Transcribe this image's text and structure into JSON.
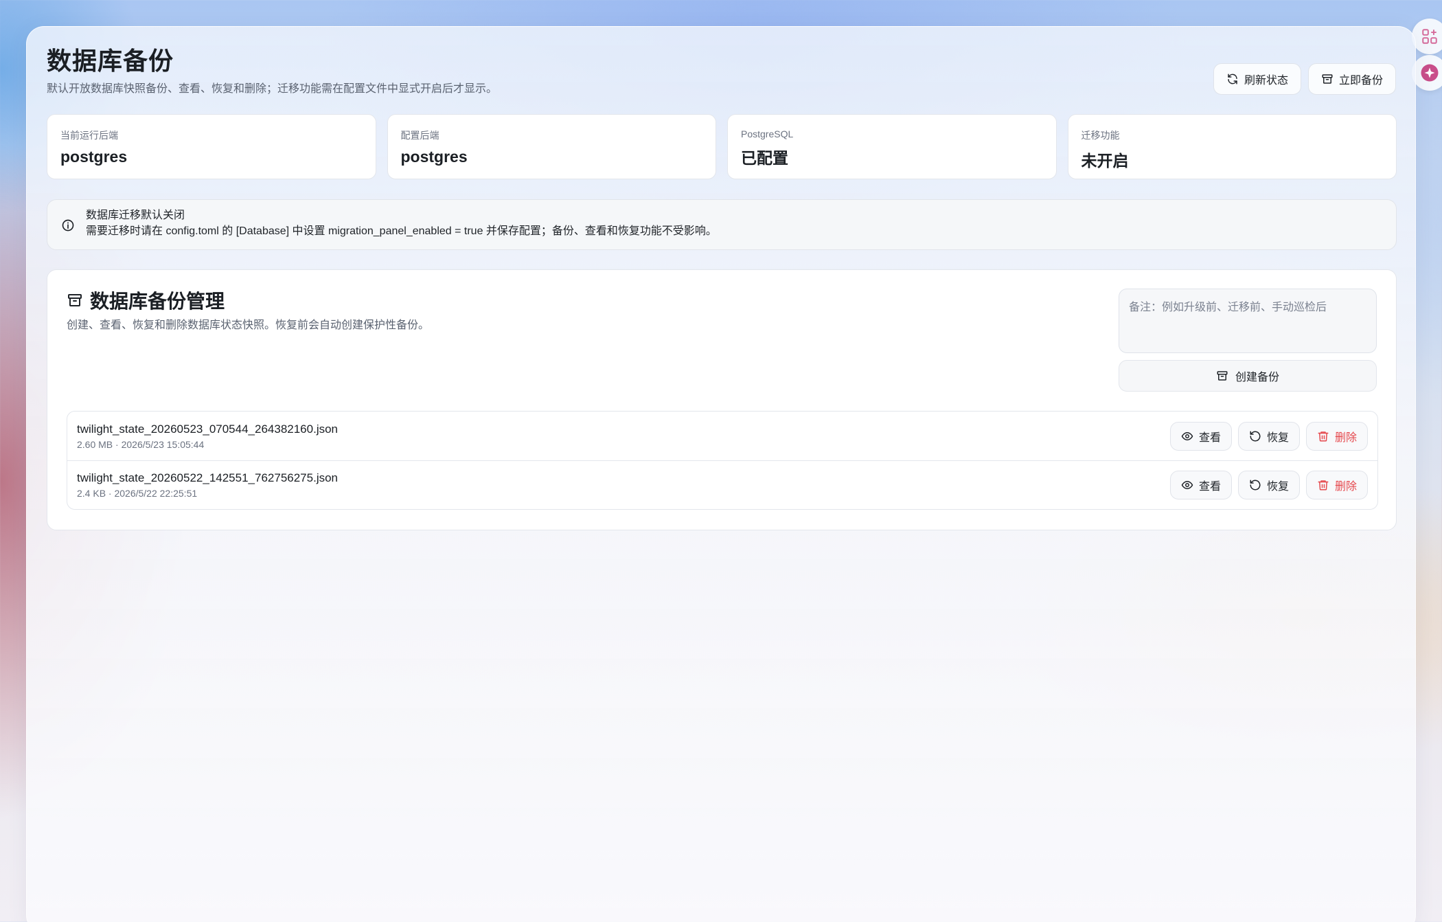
{
  "header": {
    "title": "数据库备份",
    "subtitle": "默认开放数据库快照备份、查看、恢复和删除；迁移功能需在配置文件中显式开启后才显示。",
    "refresh_label": "刷新状态",
    "backup_now_label": "立即备份"
  },
  "stats": [
    {
      "label": "当前运行后端",
      "value": "postgres"
    },
    {
      "label": "配置后端",
      "value": "postgres"
    },
    {
      "label": "PostgreSQL",
      "value": "已配置"
    },
    {
      "label": "迁移功能",
      "value": "未开启"
    }
  ],
  "alert": {
    "title": "数据库迁移默认关闭",
    "text": "需要迁移时请在 config.toml 的 [Database] 中设置 migration_panel_enabled = true 并保存配置；备份、查看和恢复功能不受影响。"
  },
  "backup": {
    "title": "数据库备份管理",
    "desc": "创建、查看、恢复和删除数据库状态快照。恢复前会自动创建保护性备份。",
    "note_placeholder": "备注：例如升级前、迁移前、手动巡检后",
    "create_label": "创建备份",
    "files": [
      {
        "name": "twilight_state_20260523_070544_264382160.json",
        "meta": "2.60 MB · 2026/5/23 15:05:44"
      },
      {
        "name": "twilight_state_20260522_142551_762756275.json",
        "meta": "2.4 KB · 2026/5/22 22:25:51"
      }
    ],
    "view_label": "查看",
    "restore_label": "恢复",
    "delete_label": "删除"
  },
  "colors": {
    "danger": "#e5484d",
    "side_icon_1": "#d56a9a",
    "side_icon_2": "#c94e8a"
  },
  "icons": [
    "refresh-icon",
    "archive-icon",
    "info-icon",
    "eye-icon",
    "restore-icon",
    "trash-icon",
    "apps-icon",
    "sparkle-icon"
  ]
}
